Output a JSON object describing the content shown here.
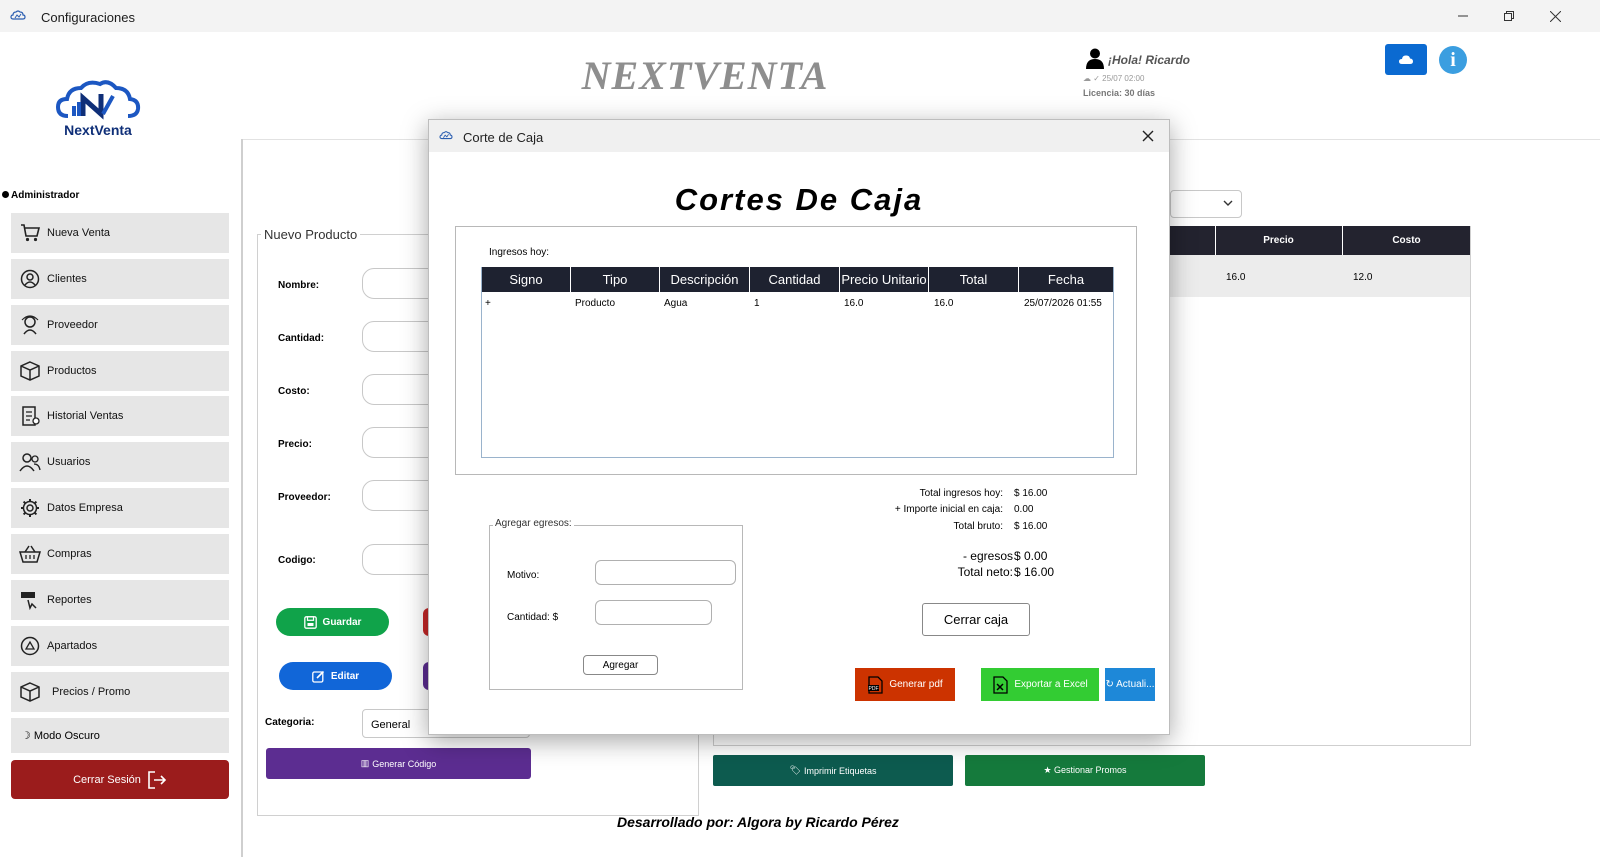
{
  "window": {
    "title": "Configuraciones"
  },
  "header": {
    "brand_title": "NEXTVENTA",
    "logo_text": "NextVenta",
    "greeting": "¡Hola! Ricardo",
    "date": "25/07 02:00",
    "license": "Licencia: 30 días"
  },
  "sidebar": {
    "role": "Administrador",
    "items": [
      {
        "label": "Nueva Venta",
        "icon": "cart-icon"
      },
      {
        "label": "Clientes",
        "icon": "clients-icon"
      },
      {
        "label": "Proveedor",
        "icon": "supplier-icon"
      },
      {
        "label": "Productos",
        "icon": "box-icon"
      },
      {
        "label": "Historial Ventas",
        "icon": "history-icon"
      },
      {
        "label": "Usuarios",
        "icon": "users-icon"
      },
      {
        "label": "Datos Empresa",
        "icon": "gear-icon"
      },
      {
        "label": "Compras",
        "icon": "basket-icon"
      },
      {
        "label": "Reportes",
        "icon": "report-icon"
      },
      {
        "label": "Apartados",
        "icon": "layaway-icon"
      },
      {
        "label": "Precios / Promo",
        "icon": "price-box-icon"
      }
    ],
    "dark_mode": "Modo Oscuro",
    "logout": "Cerrar Sesión"
  },
  "product_form": {
    "legend": "Nuevo Producto",
    "labels": {
      "nombre": "Nombre:",
      "cantidad": "Cantidad:",
      "costo": "Costo:",
      "precio": "Precio:",
      "proveedor": "Proveedor:",
      "codigo": "Codigo:"
    },
    "save": "Guardar",
    "edit": "Editar",
    "categoria_label": "Categoria:",
    "categoria_value": "General",
    "generate_code": "Generar Código"
  },
  "product_table": {
    "columns": [
      "Precio",
      "Costo"
    ],
    "row": [
      "16.0",
      "12.0"
    ]
  },
  "bottom_buttons": {
    "print_labels": "Imprimir Etiquetas",
    "manage_promos": "★ Gestionar Promos"
  },
  "footer": "Desarrollado por: Algora by Ricardo Pérez",
  "modal": {
    "title": "Corte de Caja",
    "heading": "Cortes De Caja",
    "ingresos_label": "Ingresos hoy:",
    "columns": [
      "Signo",
      "Tipo",
      "Descripción",
      "Cantidad",
      "Precio Unitario",
      "Total",
      "Fecha"
    ],
    "rows": [
      [
        "+",
        "Producto",
        "Agua",
        "1",
        "16.0",
        "16.0",
        "25/07/2026 01:55"
      ]
    ],
    "summary": {
      "total_ingresos_label": "Total ingresos hoy:",
      "total_ingresos_value": "$ 16.00",
      "importe_label": "+ Importe inicial en caja:",
      "importe_value": "0.00",
      "total_bruto_label": "Total bruto:",
      "total_bruto_value": "$ 16.00",
      "egresos_label": "- egresos",
      "egresos_value": "$ 0.00",
      "total_neto_label": "Total neto:",
      "total_neto_value": "$ 16.00"
    },
    "egresos_form": {
      "legend": "Agregar egresos:",
      "motivo_label": "Motivo:",
      "cantidad_label": "Cantidad: $",
      "add": "Agregar"
    },
    "close_register": "Cerrar caja",
    "pdf": "Generar pdf",
    "excel": "Exportar a Excel",
    "refresh": "↻ Actuali..."
  },
  "colors": {
    "primary_blue": "#0b6ad1",
    "save_green": "#10a34a",
    "edit_blue": "#1166d8",
    "logout_red": "#9b1c1c",
    "pdf_red": "#cc3300",
    "excel_green": "#33cc33",
    "table_header": "#1e2230"
  }
}
